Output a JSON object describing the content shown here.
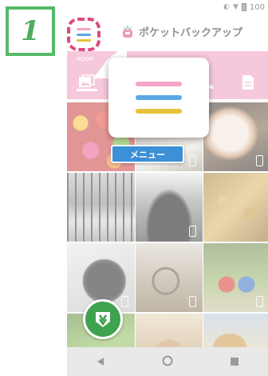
{
  "step": {
    "number": "1"
  },
  "status": {
    "battery_text": "100"
  },
  "header": {
    "app_title": "ポケットバックアップ"
  },
  "category_bar": {
    "section_label": "ROOM"
  },
  "menu_callout": {
    "label": "メニュー"
  },
  "colors": {
    "step_green": "#58b96a",
    "highlight_pink": "#e0487d",
    "menu_line_pink": "#f4a6c8",
    "menu_line_blue": "#5aa8e6",
    "menu_line_yellow": "#e8c23a",
    "category_band": "#ee9cc0",
    "menu_label_blue": "#3c90d6",
    "fab_green": "#3ea24e"
  },
  "icons": {
    "menu": "hamburger-menu-icon",
    "categories": [
      "photo-icon",
      "contacts-icon",
      "phone-icon",
      "document-icon"
    ],
    "fab": "backup-download-icon",
    "nav": [
      "back-icon",
      "home-icon",
      "recent-apps-icon"
    ]
  }
}
